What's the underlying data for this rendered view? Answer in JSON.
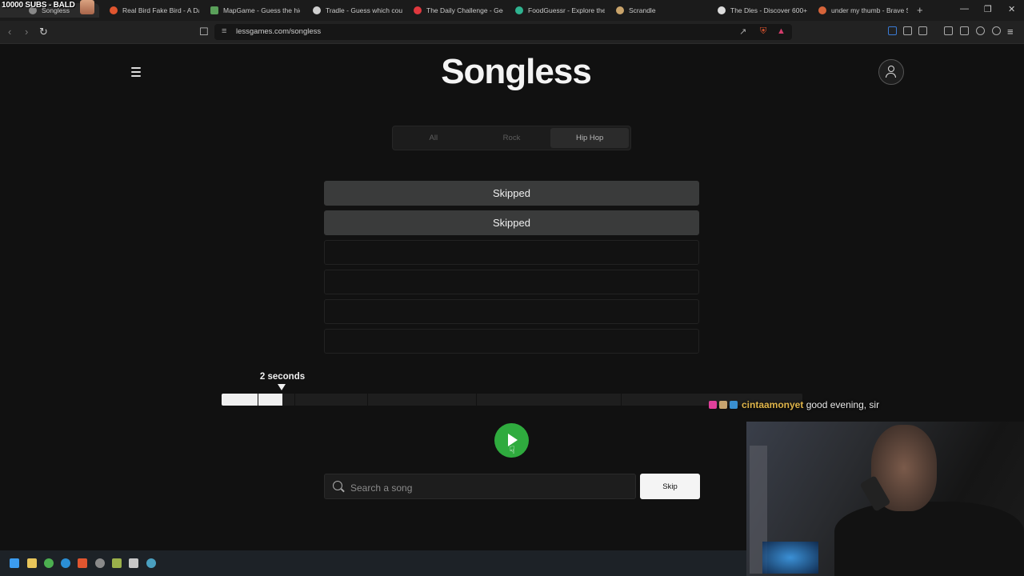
{
  "stream_overlay": {
    "sub_goal": "10000 SUBS - BALD"
  },
  "browser": {
    "tabs": [
      {
        "title": "Songless",
        "color": "#888888"
      },
      {
        "title": "Real Bird Fake Bird - A Dai",
        "color": "#e0552f"
      },
      {
        "title": "MapGame - Guess the hid",
        "color": "#5aa05a"
      },
      {
        "title": "Tradle - Guess which coun",
        "color": "#cfcfcf"
      },
      {
        "title": "The Daily Challenge - Geo",
        "color": "#e0383e"
      },
      {
        "title": "FoodGuessr - Explore the",
        "color": "#2fb390"
      },
      {
        "title": "Scrandle",
        "color": "#c9a36a"
      },
      {
        "title": "The Dles - Discover 600+",
        "color": "#dddddd"
      },
      {
        "title": "under my thumb - Brave S",
        "color": "#d6643a"
      }
    ],
    "url": "lessgames.com/songless"
  },
  "app": {
    "logo": "Songless",
    "genres": [
      "All",
      "Rock",
      "Hip Hop"
    ],
    "active_genre": "Hip Hop",
    "guesses": [
      "Skipped",
      "Skipped",
      "",
      "",
      "",
      ""
    ],
    "timer_label": "2 seconds",
    "progress_fraction": 0.104,
    "segment_seconds": [
      1,
      2,
      4,
      7,
      11,
      16
    ],
    "search_placeholder": "Search a song",
    "skip_label": "Skip",
    "accent_color": "#2fab3e"
  },
  "chat": {
    "username": "cintaamonyet",
    "message": "good evening, sir"
  }
}
